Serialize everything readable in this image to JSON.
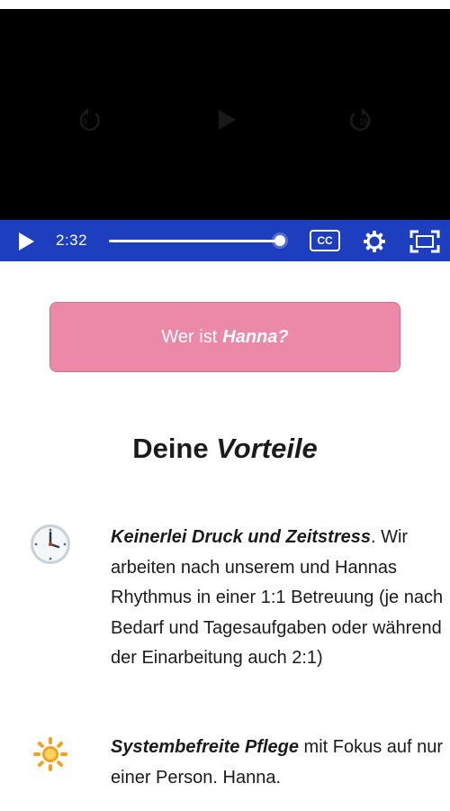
{
  "player": {
    "rewind_seconds": "15",
    "forward_seconds": "15",
    "time": "2:32",
    "progress_fraction": 0.98,
    "cc_label": "CC"
  },
  "cta": {
    "prefix": "Wer ist",
    "name": "Hanna?"
  },
  "section": {
    "heading_prefix": "Deine",
    "heading_emph": "Vorteile"
  },
  "benefits": [
    {
      "icon": "clock-icon",
      "bold": "Keinerlei Druck und Zeitstress",
      "text": ". Wir arbeiten nach unserem und Hannas Rhythmus in einer 1:1 Betreuung (je nach Bedarf und Tagesaufgaben oder während der Einarbeitung auch 2:1)"
    },
    {
      "icon": "sun-icon",
      "bold": "Systembefreite Pflege",
      "text": " mit Fokus auf nur einer Person. Hanna."
    }
  ],
  "colors": {
    "control_bar": "#1d3fbf",
    "cta_background": "#ec89a8",
    "video_background": "#000000"
  }
}
